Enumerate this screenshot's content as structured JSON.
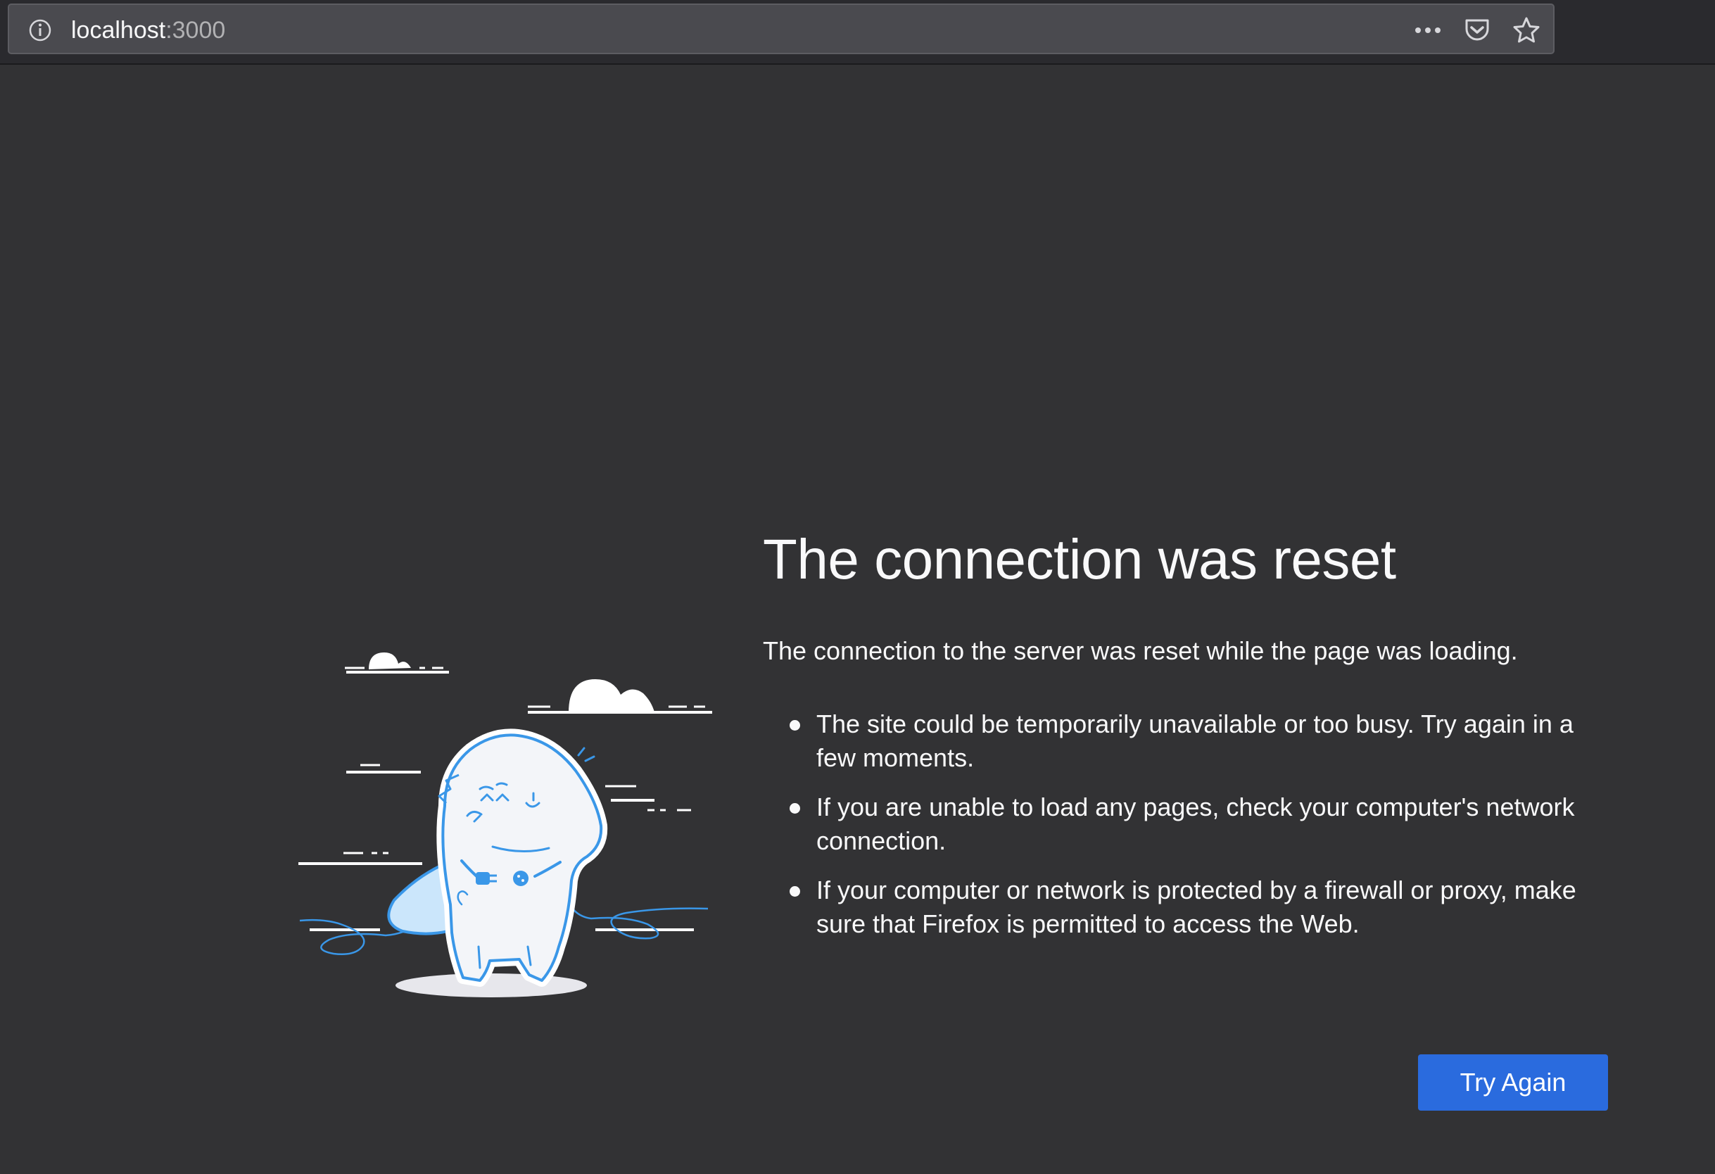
{
  "urlbar": {
    "host": "localhost",
    "port": ":3000"
  },
  "icons": {
    "site_info": "info-icon",
    "page_actions": "ellipsis-icon",
    "pocket": "pocket-icon",
    "bookmark": "star-icon"
  },
  "error": {
    "title": "The connection was reset",
    "description": "The connection to the server was reset while the page was loading.",
    "bullets": [
      "The site could be temporarily unavailable or too busy. Try again in a few moments.",
      "If you are unable to load any pages, check your computer's network connection.",
      "If your computer or network is protected by a firewall or proxy, make sure that Firefox is permitted to access the Web."
    ],
    "button_label": "Try Again"
  },
  "colors": {
    "page_background": "#323234",
    "toolbar_background": "#2a2a2e",
    "urlbar_background": "#4a4a4f",
    "button_background": "#2a6bde",
    "text": "#f9f9fa",
    "illustration_accent": "#3a97e8"
  }
}
